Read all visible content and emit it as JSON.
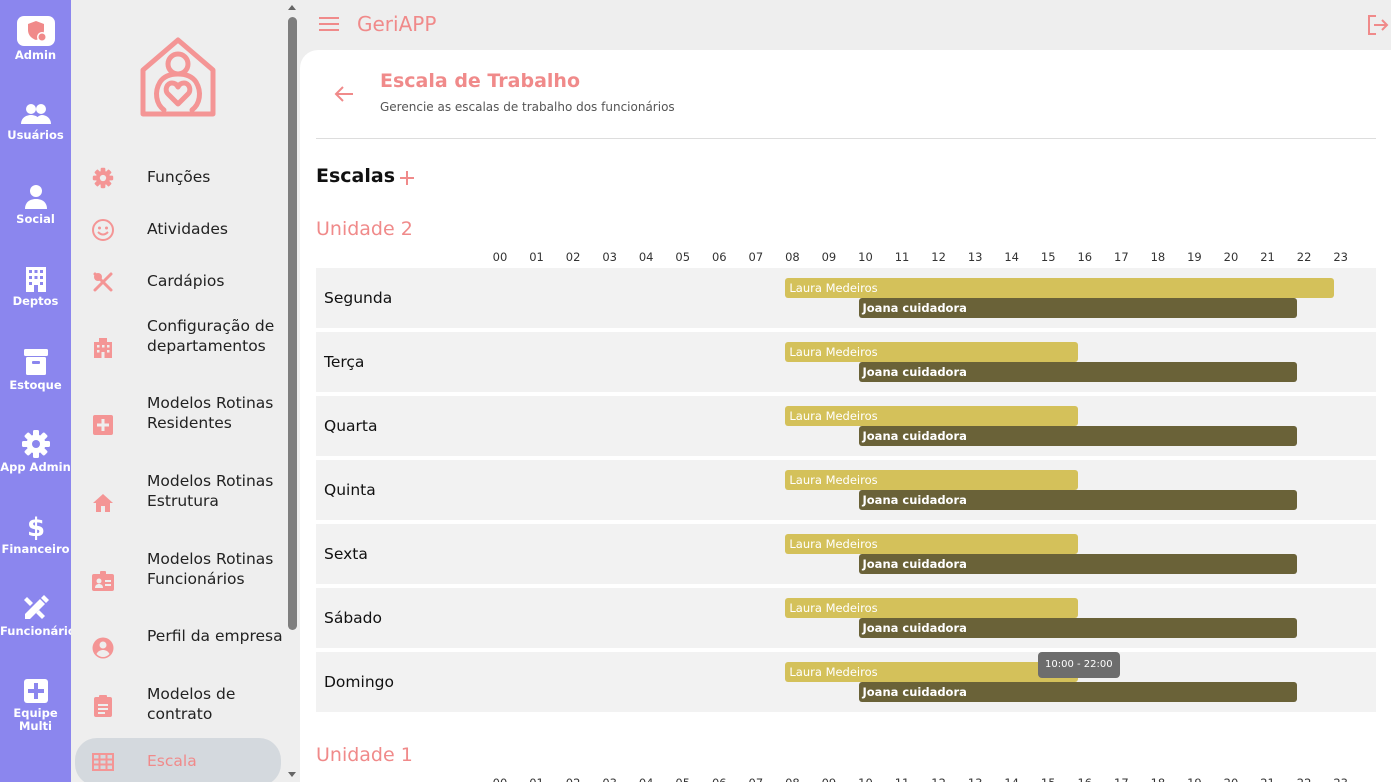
{
  "rail": {
    "items": [
      {
        "label": "Admin",
        "icon": "admin-shield-icon"
      },
      {
        "label": "Usuários",
        "icon": "users-icon"
      },
      {
        "label": "Social",
        "icon": "person-icon"
      },
      {
        "label": "Deptos",
        "icon": "building-icon"
      },
      {
        "label": "Estoque",
        "icon": "archive-icon"
      },
      {
        "label": "App Admin",
        "icon": "gear-icon"
      },
      {
        "label": "Financeiro",
        "icon": "dollar-icon"
      },
      {
        "label": "Funcionário",
        "icon": "pencil-ruler-icon"
      },
      {
        "label": "Equipe Multi",
        "icon": "medical-plus-icon"
      }
    ]
  },
  "sidebar": {
    "items": [
      {
        "label": "Funções",
        "icon": "gear-icon"
      },
      {
        "label": "Atividades",
        "icon": "smile-icon"
      },
      {
        "label": "Cardápios",
        "icon": "utensils-icon"
      },
      {
        "label": "Configuração de departamentos",
        "icon": "building-icon"
      },
      {
        "label": "Modelos Rotinas Residentes",
        "icon": "medical-box-icon"
      },
      {
        "label": "Modelos Rotinas Estrutura",
        "icon": "home-icon"
      },
      {
        "label": "Modelos Rotinas Funcionários",
        "icon": "id-badge-icon"
      },
      {
        "label": "Perfil da empresa",
        "icon": "account-circle-icon"
      },
      {
        "label": "Modelos de contrato",
        "icon": "clipboard-icon"
      },
      {
        "label": "Escala",
        "icon": "grid-icon",
        "active": true
      }
    ]
  },
  "topbar": {
    "app_title": "GeriAPP"
  },
  "page": {
    "title": "Escala de Trabalho",
    "subtitle": "Gerencie as escalas de trabalho dos funcionários",
    "section_title": "Escalas"
  },
  "hours": [
    "00",
    "01",
    "02",
    "03",
    "04",
    "05",
    "06",
    "07",
    "08",
    "09",
    "10",
    "11",
    "12",
    "13",
    "14",
    "15",
    "16",
    "17",
    "18",
    "19",
    "20",
    "21",
    "22",
    "23"
  ],
  "units": [
    {
      "name": "Unidade 2",
      "days": [
        {
          "day": "Segunda",
          "shifts": [
            {
              "name": "Laura Medeiros",
              "start": 8,
              "end": 23,
              "type": "laura"
            },
            {
              "name": "Joana cuidadora",
              "start": 10,
              "end": 22,
              "type": "joana"
            }
          ]
        },
        {
          "day": "Terça",
          "shifts": [
            {
              "name": "Laura Medeiros",
              "start": 8,
              "end": 16,
              "type": "laura"
            },
            {
              "name": "Joana cuidadora",
              "start": 10,
              "end": 22,
              "type": "joana"
            }
          ]
        },
        {
          "day": "Quarta",
          "shifts": [
            {
              "name": "Laura Medeiros",
              "start": 8,
              "end": 16,
              "type": "laura"
            },
            {
              "name": "Joana cuidadora",
              "start": 10,
              "end": 22,
              "type": "joana"
            }
          ]
        },
        {
          "day": "Quinta",
          "shifts": [
            {
              "name": "Laura Medeiros",
              "start": 8,
              "end": 16,
              "type": "laura"
            },
            {
              "name": "Joana cuidadora",
              "start": 10,
              "end": 22,
              "type": "joana"
            }
          ]
        },
        {
          "day": "Sexta",
          "shifts": [
            {
              "name": "Laura Medeiros",
              "start": 8,
              "end": 16,
              "type": "laura"
            },
            {
              "name": "Joana cuidadora",
              "start": 10,
              "end": 22,
              "type": "joana"
            }
          ]
        },
        {
          "day": "Sábado",
          "shifts": [
            {
              "name": "Laura Medeiros",
              "start": 8,
              "end": 16,
              "type": "laura"
            },
            {
              "name": "Joana cuidadora",
              "start": 10,
              "end": 22,
              "type": "joana"
            }
          ]
        },
        {
          "day": "Domingo",
          "shifts": [
            {
              "name": "Laura Medeiros",
              "start": 8,
              "end": 16,
              "type": "laura"
            },
            {
              "name": "Joana cuidadora",
              "start": 10,
              "end": 22,
              "type": "joana"
            }
          ]
        }
      ]
    },
    {
      "name": "Unidade 1",
      "days": []
    }
  ],
  "tooltip": {
    "text": "10:00 - 22:00"
  },
  "colors": {
    "accent": "#f08a8a",
    "rail": "#8b86ee",
    "laura": "#d4c15a",
    "joana": "#6a6238"
  }
}
